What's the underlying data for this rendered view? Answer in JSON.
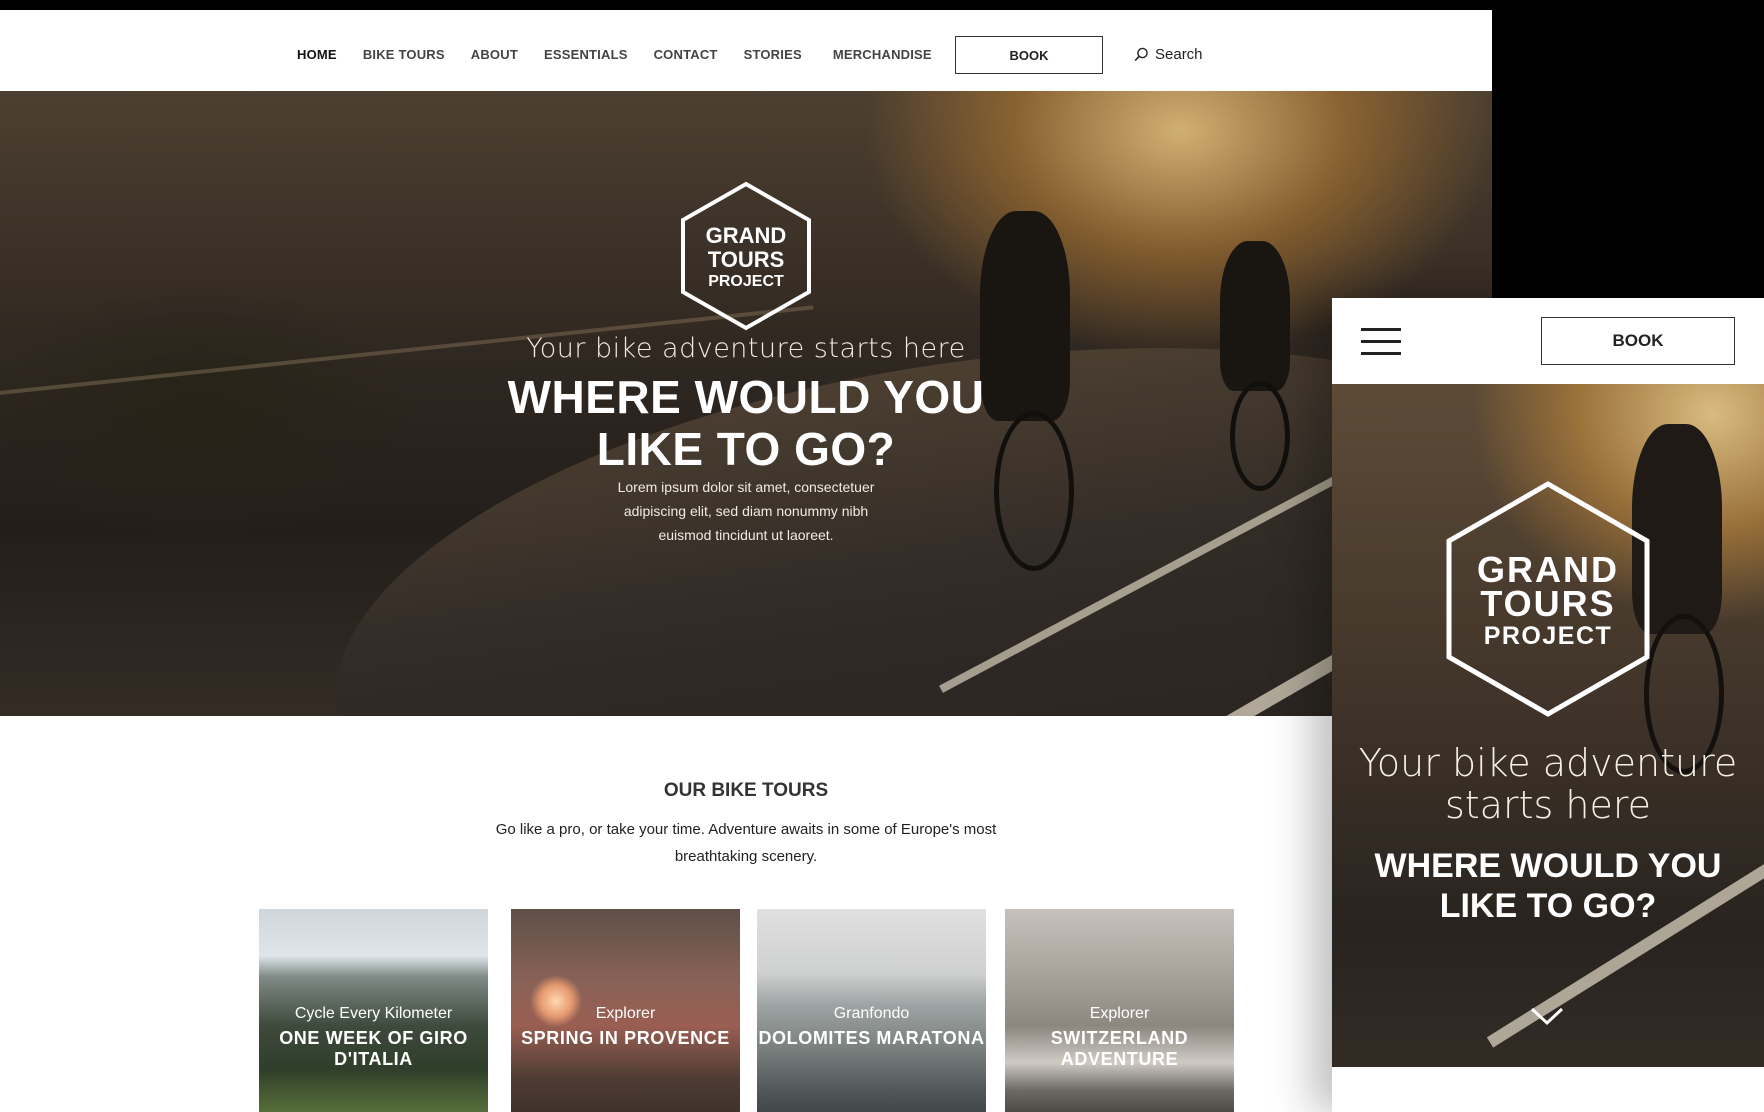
{
  "desktop": {
    "nav": {
      "items": [
        "HOME",
        "BIKE TOURS",
        "ABOUT",
        "ESSENTIALS",
        "CONTACT",
        "STORIES",
        "MERCHANDISE"
      ],
      "active": "HOME",
      "book_label": "BOOK",
      "search_label": "Search"
    },
    "hero": {
      "logo_lines": [
        "GRAND",
        "TOURS",
        "PROJECT"
      ],
      "subtitle": "Your bike adventure starts here",
      "title": "WHERE WOULD YOU LIKE TO GO?",
      "body": "Lorem ipsum dolor sit amet, consectetuer adipiscing elit, sed diam nonummy nibh euismod tincidunt ut laoreet."
    },
    "tours": {
      "title": "OUR BIKE TOURS",
      "subtitle": "Go like a pro, or take your time. Adventure awaits in some of Europe's most breathtaking scenery.",
      "cards": [
        {
          "kicker": "Cycle Every Kilometer",
          "name": "ONE WEEK OF GIRO D'ITALIA"
        },
        {
          "kicker": "Explorer",
          "name": "SPRING IN PROVENCE"
        },
        {
          "kicker": "Granfondo",
          "name": "DOLOMITES MARATONA"
        },
        {
          "kicker": "Explorer",
          "name": "SWITZERLAND ADVENTURE"
        }
      ]
    }
  },
  "mobile": {
    "book_label": "BOOK",
    "hero": {
      "logo_lines": [
        "GRAND",
        "TOURS",
        "PROJECT"
      ],
      "subtitle": "Your bike adventure starts here",
      "title": "WHERE WOULD YOU LIKE TO GO?"
    }
  }
}
